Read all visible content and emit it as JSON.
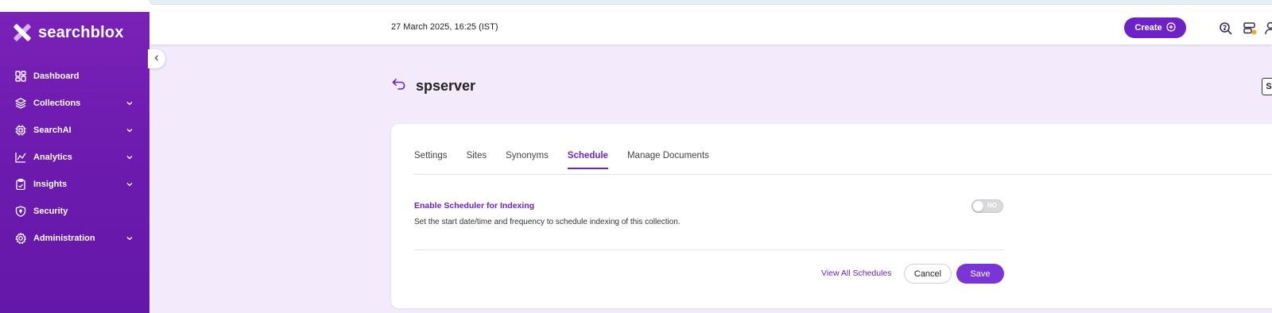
{
  "app": {
    "brand": "searchblox"
  },
  "sidebar": {
    "items": [
      {
        "label": "Dashboard",
        "icon": "dashboard-icon",
        "has_submenu": false
      },
      {
        "label": "Collections",
        "icon": "layers-icon",
        "has_submenu": true
      },
      {
        "label": "SearchAI",
        "icon": "chip-icon",
        "has_submenu": true
      },
      {
        "label": "Analytics",
        "icon": "analytics-icon",
        "has_submenu": true
      },
      {
        "label": "Insights",
        "icon": "clipboard-icon",
        "has_submenu": true
      },
      {
        "label": "Security",
        "icon": "shield-icon",
        "has_submenu": false
      },
      {
        "label": "Administration",
        "icon": "gear-icon",
        "has_submenu": true
      }
    ]
  },
  "header": {
    "datetime": "27 March 2025, 16:25 (IST)",
    "create_label": "Create",
    "icons": [
      "help-search-icon",
      "server-notification-icon",
      "user-icon"
    ]
  },
  "page": {
    "title": "spserver",
    "badge": "S"
  },
  "tabs": [
    {
      "label": "Settings",
      "active": false
    },
    {
      "label": "Sites",
      "active": false
    },
    {
      "label": "Synonyms",
      "active": false
    },
    {
      "label": "Schedule",
      "active": true
    },
    {
      "label": "Manage Documents",
      "active": false
    }
  ],
  "scheduler": {
    "title": "Enable Scheduler for Indexing",
    "description": "Set the start date/time and frequency to schedule indexing of this collection.",
    "toggle_label": "NO",
    "enabled": false
  },
  "actions": {
    "view_all": "View All Schedules",
    "cancel": "Cancel",
    "save": "Save"
  },
  "colors": {
    "sidebar": "#6e1bb0",
    "accent": "#6c22c4",
    "page_bg": "#f3ebfb",
    "notification_dot": "#f5a623"
  }
}
